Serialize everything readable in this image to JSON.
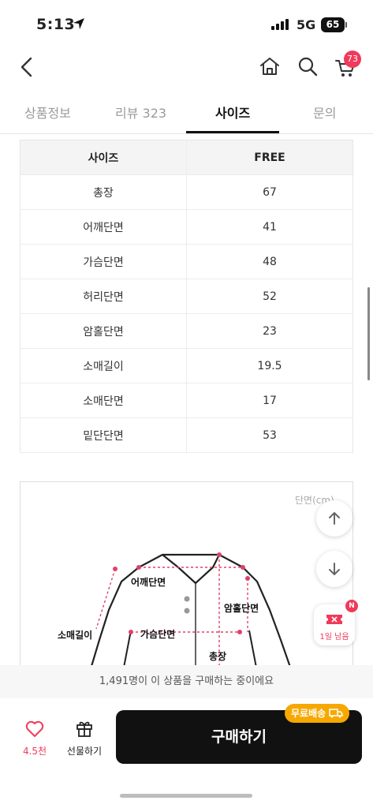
{
  "status_bar": {
    "time": "5:13",
    "network": "5G",
    "battery": "65"
  },
  "header": {
    "cart_count": "73"
  },
  "tabs": [
    {
      "label": "상품정보"
    },
    {
      "label": "리뷰 323"
    },
    {
      "label": "사이즈"
    },
    {
      "label": "문의"
    }
  ],
  "size_table": {
    "headers": [
      "사이즈",
      "FREE"
    ],
    "rows": [
      [
        "총장",
        "67"
      ],
      [
        "어깨단면",
        "41"
      ],
      [
        "가슴단면",
        "48"
      ],
      [
        "허리단면",
        "52"
      ],
      [
        "암홀단면",
        "23"
      ],
      [
        "소매길이",
        "19.5"
      ],
      [
        "소매단면",
        "17"
      ],
      [
        "밑단단면",
        "53"
      ]
    ]
  },
  "diagram": {
    "unit": "단면(cm)",
    "labels": {
      "shoulder": "어깨단면",
      "armhole": "암홀단면",
      "sleeve_length": "소매길이",
      "chest": "가슴단면",
      "length": "총장"
    }
  },
  "coupon": {
    "text": "1일 남음",
    "badge": "N"
  },
  "notice": "1,491명이 이 상품을 구매하는 중이에요",
  "bottom_bar": {
    "like_count": "4.5천",
    "gift_label": "선물하기",
    "buy_label": "구매하기",
    "free_shipping": "무료배송"
  },
  "colors": {
    "accent": "#f03a5a",
    "buy_button": "#111111",
    "free_ship": "#f7a800"
  }
}
